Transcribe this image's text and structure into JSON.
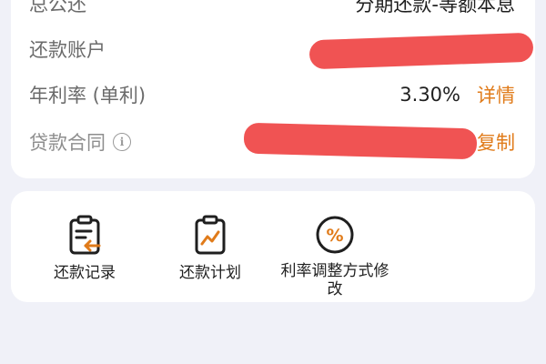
{
  "loan_info": {
    "rows": [
      {
        "label": "总公还",
        "value": "分期还款-等额本息"
      },
      {
        "label": "还款账户",
        "value": ""
      },
      {
        "label": "年利率 (单利)",
        "value": "3.30%",
        "link": "详情"
      },
      {
        "label": "贷款合同",
        "value": "",
        "link": "复制"
      }
    ],
    "info_glyph": "i"
  },
  "actions": [
    {
      "label": "还款记录",
      "icon": "clipboard-return-icon"
    },
    {
      "label": "还款计划",
      "icon": "clipboard-chart-icon"
    },
    {
      "label": "利率调整方式修改",
      "icon": "percent-circle-icon"
    }
  ],
  "colors": {
    "accent": "#e07b1a",
    "redaction": "#ef4a4a",
    "background": "#f0f1f8"
  }
}
